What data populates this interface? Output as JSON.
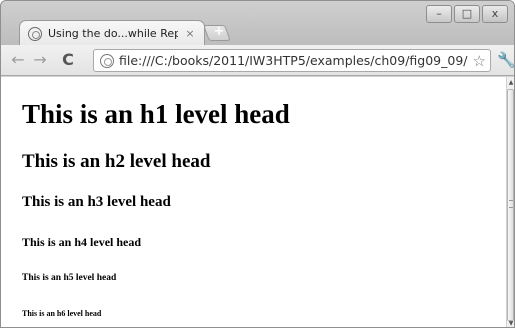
{
  "window": {
    "minimize_label": "–",
    "maximize_label": "□",
    "close_label": "x"
  },
  "tab": {
    "favicon": "page-icon",
    "title": "Using the do...while Repetit",
    "close_label": "×"
  },
  "toolbar": {
    "back_label": "←",
    "forward_label": "→",
    "reload_label": "C",
    "url": "file:///C:/books/2011/IW3HTP5/examples/ch09/fig09_09/",
    "bookmark_icon": "star-icon",
    "bookmark_label": "☆",
    "wrench_label": "🔧",
    "new_tab_label": "+"
  },
  "content": {
    "h1": "This is an h1 level head",
    "h2": "This is an h2 level head",
    "h3": "This is an h3 level head",
    "h4": "This is an h4 level head",
    "h5": "This is an h5 level head",
    "h6": "This is an h6 level head"
  },
  "scrollbar": {
    "up_label": "▲",
    "down_label": "▼"
  }
}
